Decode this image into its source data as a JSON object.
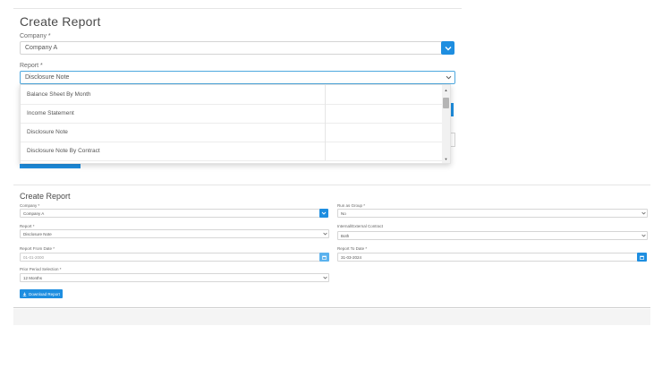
{
  "top": {
    "title": "Create Report",
    "company_label": "Company *",
    "company_value": "Company A",
    "report_label": "Report *",
    "report_value": "Disclosure Note",
    "dropdown_options": [
      "Balance Sheet By Month",
      "Income Statement",
      "Disclosure Note",
      "Disclosure Note By Contract"
    ]
  },
  "bottom": {
    "title": "Create Report",
    "company_label": "Company *",
    "company_value": "Company A",
    "report_label": "Report *",
    "report_value": "Disclosure Note",
    "from_label": "Report From Date *",
    "from_value": "01-01-2000",
    "to_label": "Report To Date *",
    "to_value": "31-03-2024",
    "prior_label": "Prior Period Selection *",
    "prior_value": "12 Months",
    "group_label": "Run as Group *",
    "group_value": "No",
    "contract_label": "Internal/External Contract",
    "contract_value": "Both",
    "download_label": "Download Report"
  },
  "colors": {
    "primary": "#1e8ee0",
    "primary_light": "#5bb2ee",
    "focus_border": "#4ea8de"
  },
  "icons": [
    "chevron-down-icon",
    "calendar-icon",
    "download-icon",
    "scroll-up-icon",
    "scroll-down-icon"
  ]
}
